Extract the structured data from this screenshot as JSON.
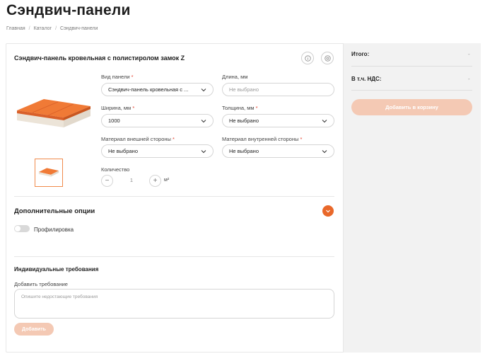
{
  "page": {
    "title": "Сэндвич-панели",
    "breadcrumb": [
      "Главная",
      "Каталог",
      "Сэндвич-панели"
    ]
  },
  "product": {
    "title": "Сэндвич-панель кровельная с полистиролом замок Z",
    "info_icon": "info-icon",
    "settings_icon": "settings-icon"
  },
  "form": {
    "panel_type": {
      "label": "Вид панели",
      "value": "Сэндвич-панель кровельная с ..."
    },
    "length": {
      "label": "Длина, мм",
      "placeholder": "Не выбрано"
    },
    "width": {
      "label": "Ширина, мм",
      "value": "1000"
    },
    "thickness": {
      "label": "Толщина, мм",
      "value": "Не выбрано"
    },
    "outer_material": {
      "label": "Материал внешней стороны",
      "value": "Не выбрано"
    },
    "inner_material": {
      "label": "Материал внутренней стороны",
      "value": "Не выбрано"
    },
    "quantity": {
      "label": "Количество",
      "value": "1",
      "minus": "−",
      "plus": "+",
      "unit": "м²"
    },
    "required_mark": "*"
  },
  "options": {
    "title": "Дополнительные опции",
    "profiling_label": "Профилировка",
    "profiling_enabled": false
  },
  "requirements": {
    "title": "Индивидуальные требования",
    "add_label": "Добавить требование",
    "placeholder": "Опишите недостающие требования",
    "add_button": "Добавить"
  },
  "summary": {
    "total_label": "Итого:",
    "total_value": "-",
    "vat_label": "В т.ч. НДС:",
    "vat_value": "-",
    "cart_button": "Добавить в корзину"
  },
  "colors": {
    "accent": "#e9682a",
    "accent_disabled": "#f4c9b4"
  }
}
